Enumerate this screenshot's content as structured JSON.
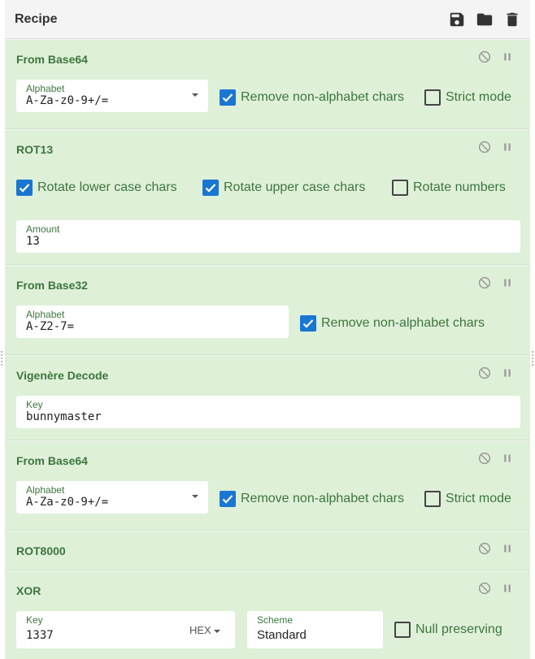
{
  "recipe": {
    "title": "Recipe",
    "icons": {
      "save": "save-icon",
      "load": "folder-icon",
      "clear": "trash-icon"
    },
    "colors": {
      "op_bg": "#dff0d8",
      "op_title": "#3c763d",
      "checkbox_on": "#1976d2",
      "header_bg": "#f4f4f4"
    }
  },
  "ops": [
    {
      "title": "From Base64",
      "alphabet_label": "Alphabet",
      "alphabet_value": "A-Za-z0-9+/=",
      "remove_label": "Remove non-alphabet chars",
      "remove_checked": true,
      "strict_label": "Strict mode",
      "strict_checked": false
    },
    {
      "title": "ROT13",
      "lower_label": "Rotate lower case chars",
      "lower_checked": true,
      "upper_label": "Rotate upper case chars",
      "upper_checked": true,
      "numbers_label": "Rotate numbers",
      "numbers_checked": false,
      "amount_label": "Amount",
      "amount_value": "13"
    },
    {
      "title": "From Base32",
      "alphabet_label": "Alphabet",
      "alphabet_value": "A-Z2-7=",
      "remove_label": "Remove non-alphabet chars",
      "remove_checked": true
    },
    {
      "title": "Vigenère Decode",
      "key_label": "Key",
      "key_value": "bunnymaster"
    },
    {
      "title": "From Base64",
      "alphabet_label": "Alphabet",
      "alphabet_value": "A-Za-z0-9+/=",
      "remove_label": "Remove non-alphabet chars",
      "remove_checked": true,
      "strict_label": "Strict mode",
      "strict_checked": false
    },
    {
      "title": "ROT8000"
    },
    {
      "title": "XOR",
      "key_label": "Key",
      "key_value": "1337",
      "key_format": "HEX",
      "scheme_label": "Scheme",
      "scheme_value": "Standard",
      "null_label": "Null preserving",
      "null_checked": false
    }
  ]
}
